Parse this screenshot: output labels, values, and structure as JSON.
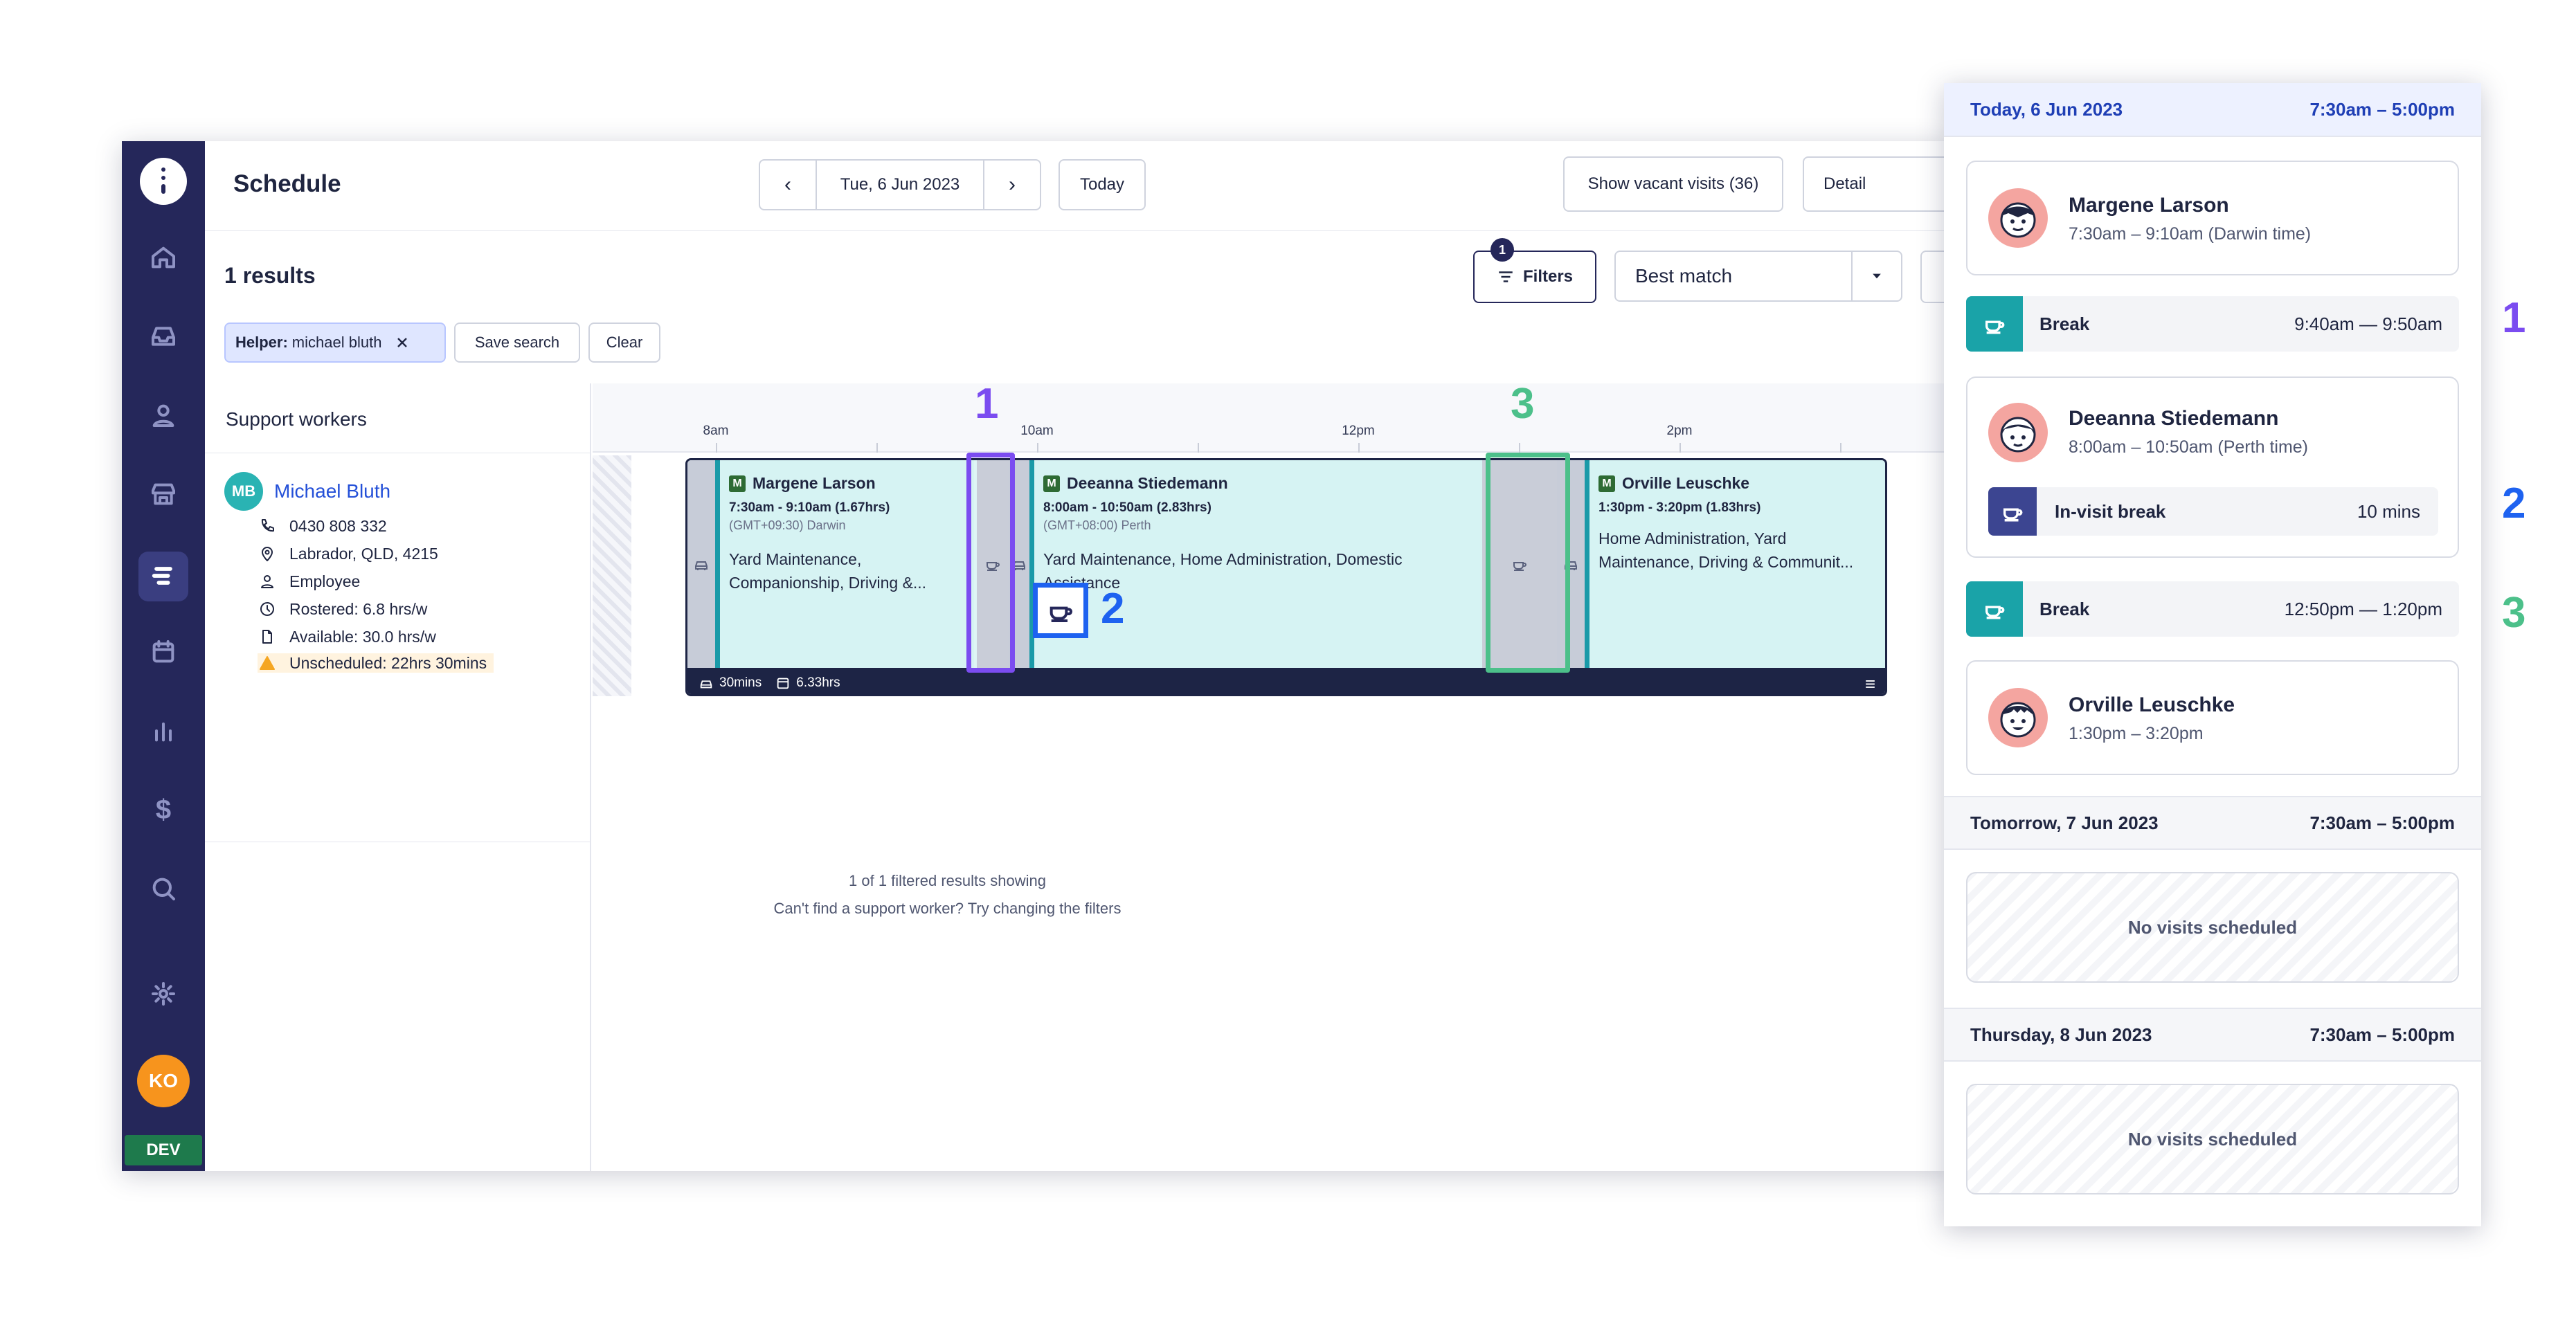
{
  "header": {
    "title": "Schedule",
    "date": "Tue, 6 Jun 2023",
    "today_label": "Today",
    "vacant_label": "Show vacant visits (36)",
    "view_label": "Detail"
  },
  "toolbar": {
    "results": "1 results",
    "filters_label": "Filters",
    "filters_count": "1",
    "sort_value": "Best match",
    "chip_key": "Helper:",
    "chip_value": "michael bluth",
    "save_search": "Save search",
    "clear": "Clear"
  },
  "workers": {
    "title": "Support workers",
    "initials": "MB",
    "name": "Michael Bluth",
    "phone": "0430 808 332",
    "location": "Labrador, QLD, 4215",
    "role": "Employee",
    "rostered": "Rostered: 6.8 hrs/w",
    "available": "Available: 30.0 hrs/w",
    "unscheduled": "Unscheduled: 22hrs 30mins"
  },
  "timeline": {
    "ticks": [
      "8am",
      "10am",
      "12pm",
      "2pm"
    ],
    "visits": [
      {
        "badge": "M",
        "name": "Margene Larson",
        "time": "7:30am - 9:10am (1.67hrs)",
        "tz": "(GMT+09:30) Darwin",
        "desc1": "Yard Maintenance,",
        "desc2": "Companionship, Driving &..."
      },
      {
        "badge": "M",
        "name": "Deeanna Stiedemann",
        "time": "8:00am - 10:50am (2.83hrs)",
        "tz": "(GMT+08:00) Perth",
        "desc1": "Yard Maintenance, Home Administration, Domestic",
        "desc2": "Assistance"
      },
      {
        "badge": "M",
        "name": "Orville Leuschke",
        "time": "1:30pm - 3:20pm (1.83hrs)",
        "desc1": "Home Administration, Yard",
        "desc2": "Maintenance, Driving & Communit..."
      }
    ],
    "footer_travel": "30mins",
    "footer_total": "6.33hrs",
    "filtered_msg": "1 of 1 filtered results showing",
    "hint_msg": "Can't find a support worker? Try changing the filters"
  },
  "annotations": {
    "one": "1",
    "two": "2",
    "three": "3"
  },
  "colors": {
    "purple": "#7b4cf0",
    "blue": "#1e62f0",
    "green": "#4cc08a",
    "navy": "#25275a",
    "teal": "#1aa3a8"
  },
  "sidebar": {
    "avatar": "KO",
    "env": "DEV",
    "icons": [
      "home-icon",
      "inbox-icon",
      "user-icon",
      "store-icon",
      "schedule-icon",
      "calendar-icon",
      "chart-icon",
      "dollar-icon",
      "search-icon",
      "gear-icon"
    ],
    "dollar": "$"
  },
  "panel": {
    "today_label": "Today, 6 Jun 2023",
    "today_hours": "7:30am – 5:00pm",
    "visit1_name": "Margene Larson",
    "visit1_time": "7:30am – 9:10am  (Darwin time)",
    "break1_label": "Break",
    "break1_time": "9:40am — 9:50am",
    "visit2_name": "Deeanna Stiedemann",
    "visit2_time": "8:00am – 10:50am  (Perth time)",
    "ivb_label": "In-visit break",
    "ivb_time": "10 mins",
    "break2_label": "Break",
    "break2_time": "12:50pm — 1:20pm",
    "visit3_name": "Orville Leuschke",
    "visit3_time": "1:30pm – 3:20pm",
    "tomorrow_label": "Tomorrow, 7 Jun 2023",
    "tomorrow_hours": "7:30am – 5:00pm",
    "tomorrow_empty": "No visits scheduled",
    "thursday_label": "Thursday, 8 Jun 2023",
    "thursday_hours": "7:30am – 5:00pm",
    "thursday_empty": "No visits scheduled"
  }
}
